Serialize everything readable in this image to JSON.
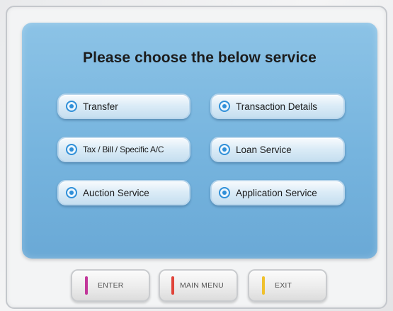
{
  "screen": {
    "title": "Please choose the below service"
  },
  "services": [
    {
      "label": "Transfer",
      "icon": "radio-icon"
    },
    {
      "label": "Transaction Details",
      "icon": "radio-icon"
    },
    {
      "label": "Tax / Bill / Specific A/C",
      "icon": "radio-icon"
    },
    {
      "label": "Loan Service",
      "icon": "radio-icon"
    },
    {
      "label": "Auction Service",
      "icon": "radio-icon"
    },
    {
      "label": "Application Service",
      "icon": "radio-icon"
    }
  ],
  "controls": {
    "enter": {
      "label": "ENTER",
      "color": "#c2379a"
    },
    "main_menu": {
      "label": "MAIN MENU",
      "color": "#e0443a"
    },
    "exit": {
      "label": "EXIT",
      "color": "#f0c12e"
    }
  },
  "colors": {
    "screen": "#7fb9df",
    "radio_accent": "#2f8fd8"
  }
}
